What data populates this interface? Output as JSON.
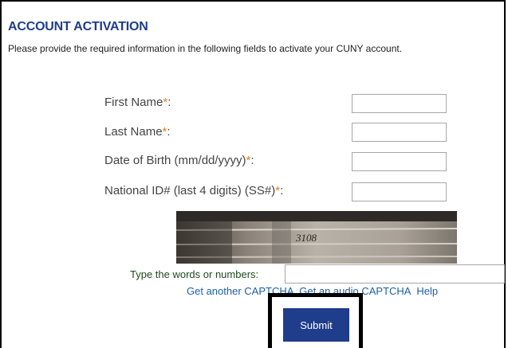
{
  "page": {
    "title": "ACCOUNT ACTIVATION",
    "instructions": "Please provide the required information in the following fields to activate your CUNY account."
  },
  "form": {
    "required_marker": "*",
    "colon": ":",
    "fields": [
      {
        "label": "First Name",
        "value": ""
      },
      {
        "label": "Last Name",
        "value": ""
      },
      {
        "label": "Date of Birth (mm/dd/yyyy)",
        "value": ""
      },
      {
        "label": "National ID# (last 4 digits) (SS#)",
        "value": ""
      }
    ]
  },
  "captcha": {
    "image_text": "3108",
    "prompt": "Type the words or numbers:",
    "value": "",
    "links": {
      "another": "Get another CAPTCHA",
      "audio": "Get an audio CAPTCHA",
      "help": "Help"
    }
  },
  "actions": {
    "submit_label": "Submit"
  },
  "colors": {
    "title": "#1f3d8a",
    "required": "#e0801a",
    "link": "#1c5fa8",
    "button": "#1f3d8a"
  }
}
